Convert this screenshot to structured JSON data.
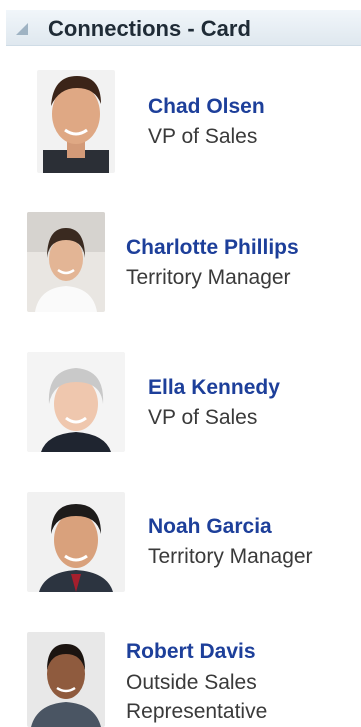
{
  "panel": {
    "title": "Connections - Card"
  },
  "connections": [
    {
      "name": "Chad Olsen",
      "title": "VP of Sales"
    },
    {
      "name": "Charlotte Phillips",
      "title": "Territory Manager"
    },
    {
      "name": "Ella Kennedy",
      "title": "VP of Sales"
    },
    {
      "name": "Noah Garcia",
      "title": "Territory Manager"
    },
    {
      "name": "Robert Davis",
      "title_lines": [
        "Outside Sales",
        "Representative"
      ]
    }
  ]
}
